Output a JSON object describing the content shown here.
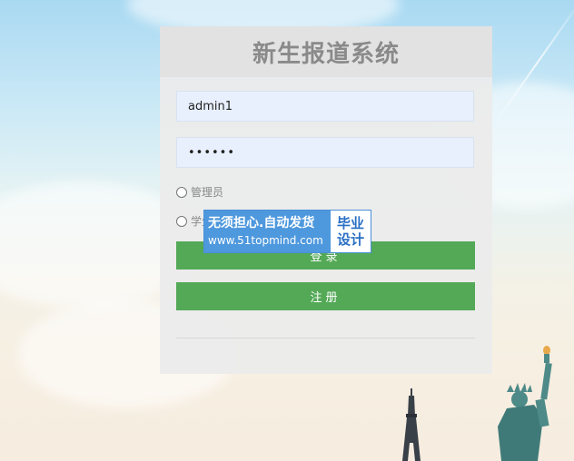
{
  "login": {
    "title": "新生报道系统",
    "username_value": "admin1",
    "password_value": "••••••",
    "role_admin_label": "管理员",
    "role_student_label": "学生",
    "login_button": "登录",
    "register_button": "注册"
  },
  "watermark": {
    "line1": "无须担心.自动发货",
    "line2": "www.51topmind.com",
    "right_line1": "毕业",
    "right_line2": "设计"
  },
  "colors": {
    "button_green": "#54a957",
    "panel_bg": "#ebebeb",
    "input_bg": "#e8f0fe",
    "title_gray": "#8a8a8a",
    "watermark_blue": "#4e98dd"
  }
}
